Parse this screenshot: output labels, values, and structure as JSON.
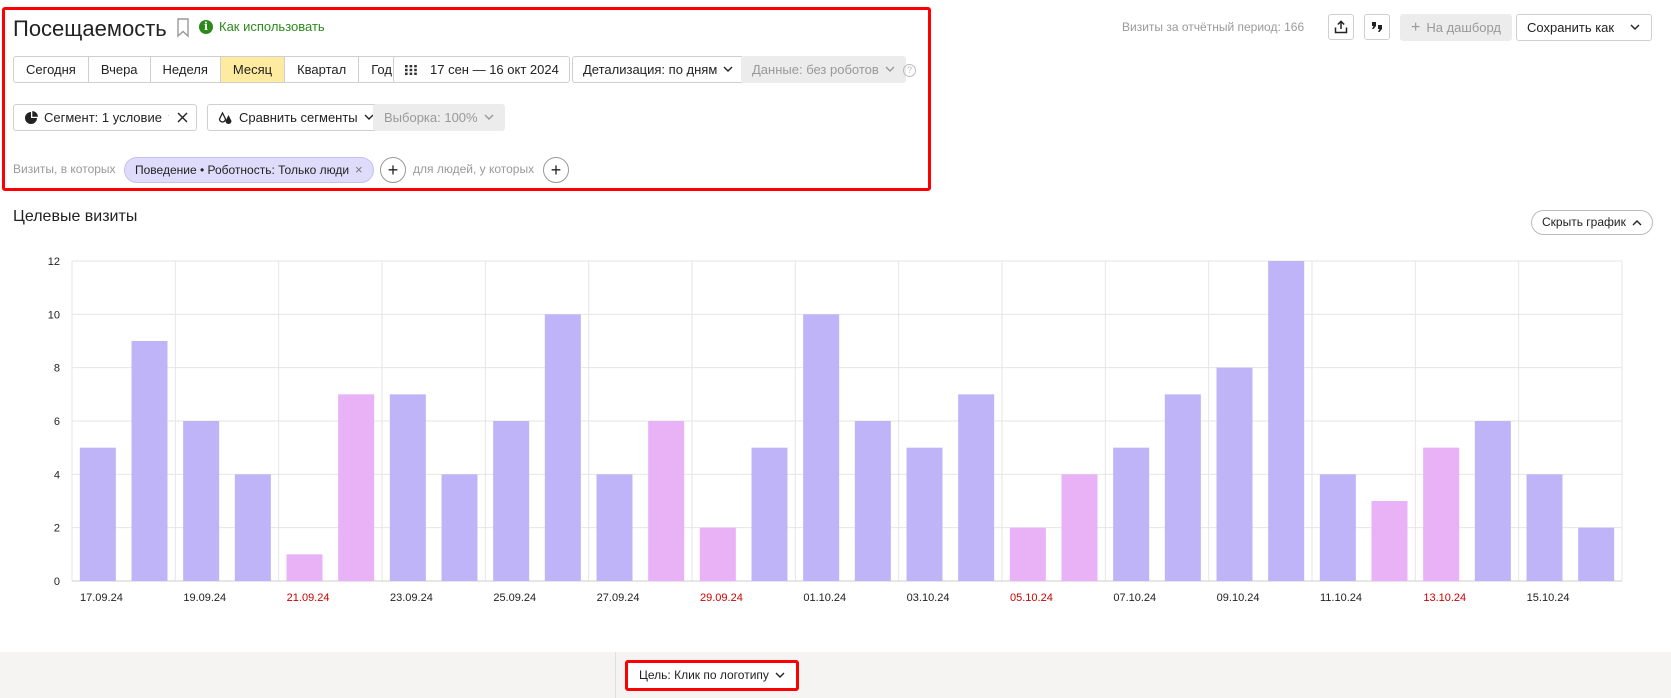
{
  "header": {
    "title": "Посещаемость",
    "howto_label": "Как использовать",
    "info_glyph": "i",
    "visits_label": "Визиты за отчётный период: 166",
    "dashboard_label": "На дашборд",
    "save_as_label": "Сохранить как"
  },
  "periods": [
    "Сегодня",
    "Вчера",
    "Неделя",
    "Месяц",
    "Квартал",
    "Год"
  ],
  "active_period": "Месяц",
  "date_range": "17 сен — 16 окт 2024",
  "detail_label": "Детализация: по дням",
  "data_label": "Данные: без роботов",
  "help_glyph": "?",
  "segment": {
    "label": "Сегмент: 1 условие",
    "compare_label": "Сравнить сегменты",
    "sample_label": "Выборка: 100%"
  },
  "filter": {
    "visits_label": "Визиты, в которых",
    "chip_label": "Поведение • Роботность: Только люди",
    "chip_close": "×",
    "people_label": "для людей, у которых",
    "plus_glyph": "+"
  },
  "section": {
    "title": "Целевые визиты",
    "hide_chart_label": "Скрыть график"
  },
  "goal_label": "Цель: Клик по логотипу",
  "colors": {
    "weekday_bar": "#c0b4f8",
    "weekend_bar": "#e9b2f7",
    "weekend_label": "#cc0000",
    "grid": "#e6e6e6"
  },
  "chart_data": {
    "type": "bar",
    "categories": [
      "17.09.24",
      "18.09.24",
      "19.09.24",
      "20.09.24",
      "21.09.24",
      "22.09.24",
      "23.09.24",
      "24.09.24",
      "25.09.24",
      "26.09.24",
      "27.09.24",
      "28.09.24",
      "29.09.24",
      "30.09.24",
      "01.10.24",
      "02.10.24",
      "03.10.24",
      "04.10.24",
      "05.10.24",
      "06.10.24",
      "07.10.24",
      "08.10.24",
      "09.10.24",
      "10.10.24",
      "11.10.24",
      "12.10.24",
      "13.10.24",
      "14.10.24",
      "15.10.24",
      "16.10.24"
    ],
    "values": [
      5,
      9,
      6,
      4,
      1,
      7,
      7,
      4,
      6,
      10,
      4,
      6,
      2,
      5,
      10,
      6,
      5,
      7,
      2,
      4,
      5,
      7,
      8,
      12,
      4,
      3,
      5,
      6,
      4,
      2
    ],
    "weekend": [
      false,
      false,
      false,
      false,
      true,
      true,
      false,
      false,
      false,
      false,
      false,
      true,
      true,
      false,
      false,
      false,
      false,
      false,
      true,
      true,
      false,
      false,
      false,
      false,
      false,
      true,
      true,
      false,
      false,
      false
    ],
    "xlabels": [
      "17.09.24",
      "19.09.24",
      "21.09.24",
      "23.09.24",
      "25.09.24",
      "27.09.24",
      "29.09.24",
      "01.10.24",
      "03.10.24",
      "05.10.24",
      "07.10.24",
      "09.10.24",
      "11.10.24",
      "13.10.24",
      "15.10.24"
    ],
    "xlabel_weekend": [
      false,
      false,
      true,
      false,
      false,
      false,
      true,
      false,
      false,
      true,
      false,
      false,
      false,
      true,
      false
    ],
    "yticks": [
      0,
      2,
      4,
      6,
      8,
      10,
      12
    ],
    "ylim": [
      0,
      12
    ],
    "grid": true
  }
}
